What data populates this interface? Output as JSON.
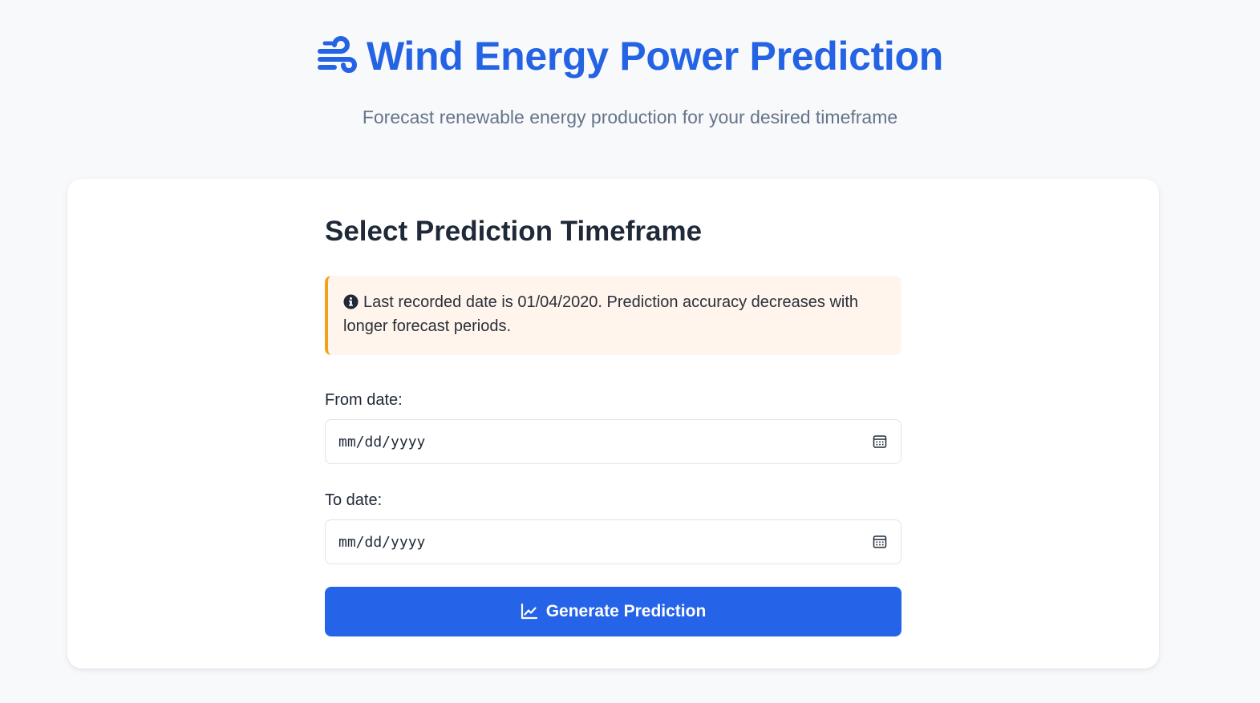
{
  "header": {
    "title": "Wind Energy Power Prediction",
    "subtitle": "Forecast renewable energy production for your desired timeframe",
    "icon": "wind-icon"
  },
  "form": {
    "section_title": "Select Prediction Timeframe",
    "notice": {
      "icon": "info-circle-icon",
      "text": "Last recorded date is 01/04/2020. Prediction accuracy decreases with longer forecast periods."
    },
    "from_date": {
      "label": "From date:",
      "value": "mm/dd/yyyy"
    },
    "to_date": {
      "label": "To date:",
      "value": "mm/dd/yyyy"
    },
    "submit": {
      "label": "Generate Prediction",
      "icon": "chart-line-icon"
    }
  },
  "colors": {
    "brand": "#2463e3",
    "button": "#2563e8",
    "notice_bg": "#fff5ec",
    "notice_accent": "#f2a11d",
    "page_bg": "#f8f9fb"
  }
}
